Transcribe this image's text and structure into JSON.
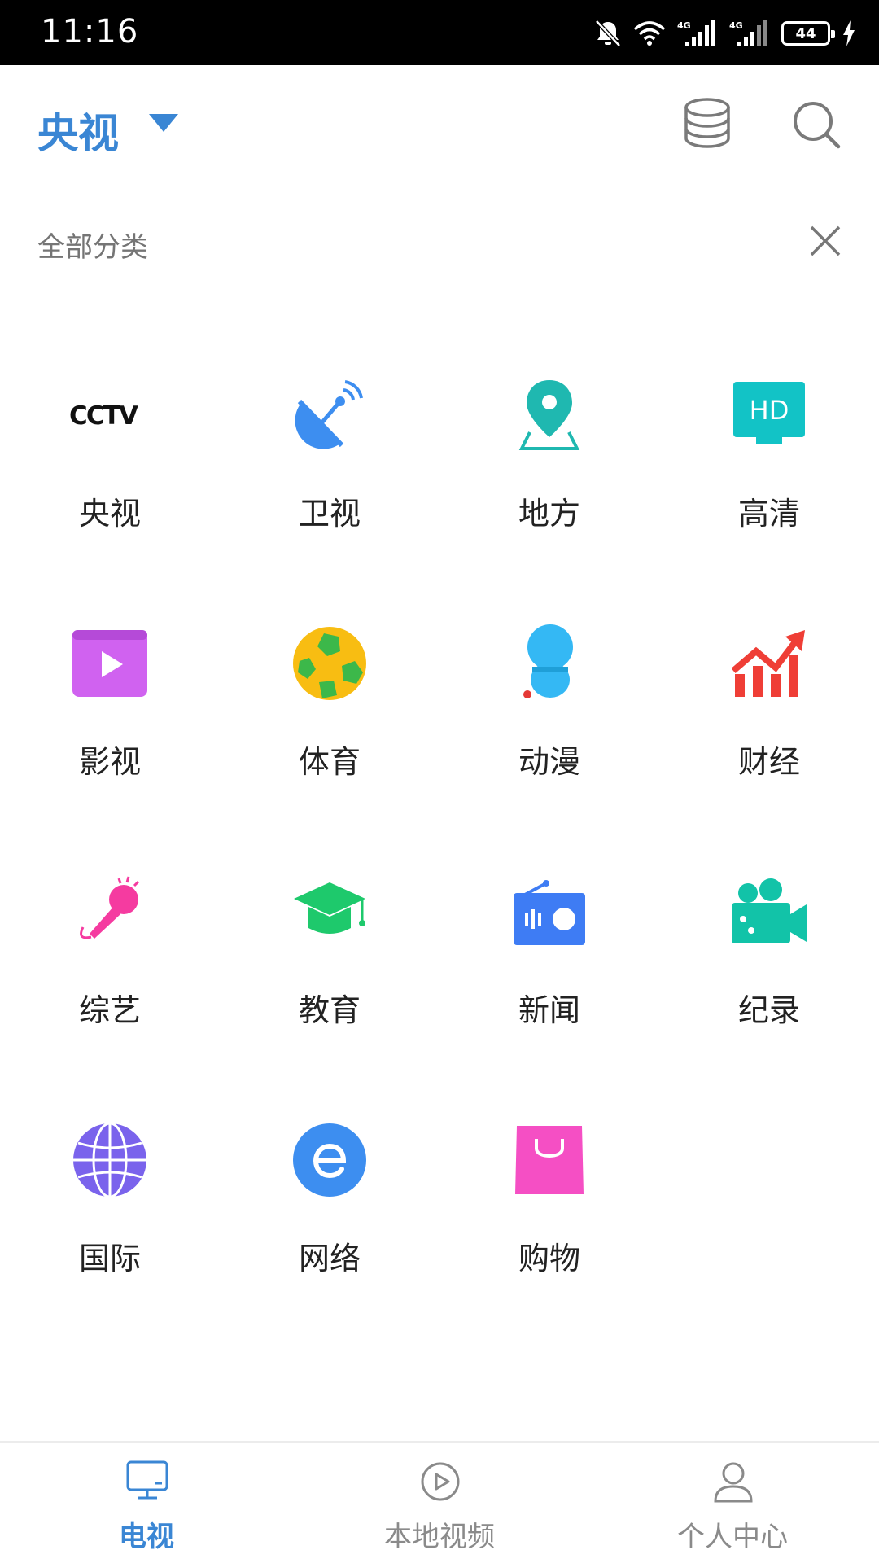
{
  "status_bar": {
    "time": "11:16",
    "battery": "44"
  },
  "header": {
    "title": "央视"
  },
  "section": {
    "title": "全部分类"
  },
  "categories": [
    {
      "label": "央视",
      "icon": "cctv-logo-icon"
    },
    {
      "label": "卫视",
      "icon": "satellite-dish-icon"
    },
    {
      "label": "地方",
      "icon": "location-pin-icon"
    },
    {
      "label": "高清",
      "icon": "hd-tv-icon"
    },
    {
      "label": "影视",
      "icon": "movie-clapper-icon"
    },
    {
      "label": "体育",
      "icon": "soccer-ball-icon"
    },
    {
      "label": "动漫",
      "icon": "cartoon-character-icon"
    },
    {
      "label": "财经",
      "icon": "finance-chart-icon"
    },
    {
      "label": "综艺",
      "icon": "microphone-icon"
    },
    {
      "label": "教育",
      "icon": "graduation-cap-icon"
    },
    {
      "label": "新闻",
      "icon": "radio-icon"
    },
    {
      "label": "纪录",
      "icon": "video-camera-icon"
    },
    {
      "label": "国际",
      "icon": "globe-icon"
    },
    {
      "label": "网络",
      "icon": "internet-e-icon"
    },
    {
      "label": "购物",
      "icon": "shopping-bag-icon"
    }
  ],
  "cctv_logo_text": "CCTV",
  "hd_text": "HD",
  "bottom_nav": [
    {
      "label": "电视",
      "icon": "tv-icon",
      "active": true
    },
    {
      "label": "本地视频",
      "icon": "play-circle-icon",
      "active": false
    },
    {
      "label": "个人中心",
      "icon": "user-icon",
      "active": false
    }
  ],
  "colors": {
    "accent": "#3a86d4",
    "label": "#222222",
    "muted": "#8a8a8a"
  }
}
